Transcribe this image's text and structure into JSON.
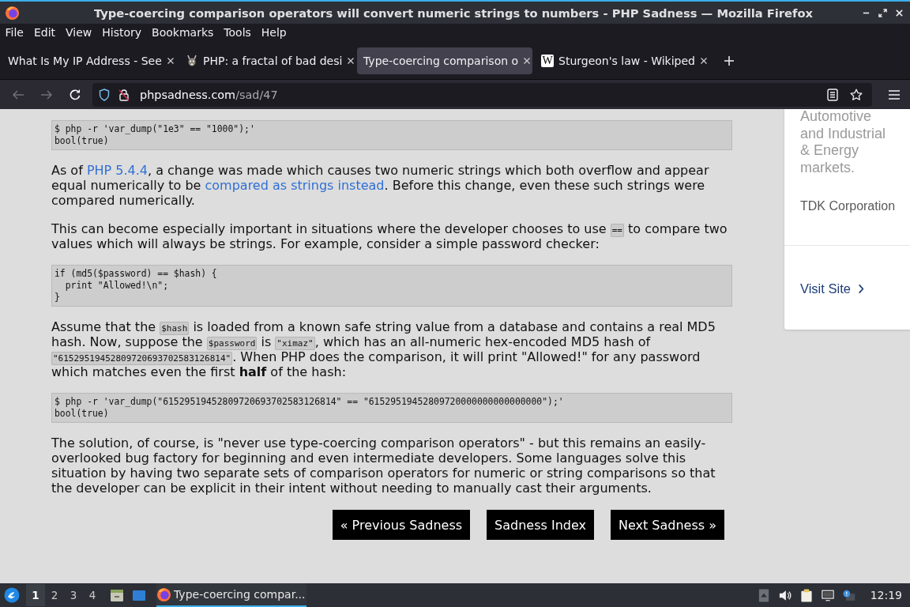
{
  "window": {
    "title": "Type-coercing comparison operators will convert numeric strings to numbers - PHP Sadness — Mozilla Firefox"
  },
  "menu": [
    "File",
    "Edit",
    "View",
    "History",
    "Bookmarks",
    "Tools",
    "Help"
  ],
  "tabs": [
    {
      "label": "What Is My IP Address - See",
      "kind": "plain",
      "selected": false
    },
    {
      "label": "PHP: a fractal of bad desi",
      "kind": "picture",
      "selected": false
    },
    {
      "label": "Type-coercing comparison o",
      "kind": "plain",
      "selected": true
    },
    {
      "label": "Sturgeon's law - Wikiped",
      "kind": "letter",
      "letter": "W",
      "selected": false
    }
  ],
  "nav_buttons": [
    {
      "kind": "back",
      "disabled": true
    },
    {
      "kind": "forward",
      "disabled": true
    },
    {
      "kind": "reload",
      "disabled": false
    }
  ],
  "url": {
    "host": "phpsadness.com",
    "path": "/sad/47"
  },
  "article": [
    {
      "kind": "code",
      "text": "$ php -r 'var_dump(\"1e3\" == \"1000\");'\nbool(true)"
    },
    {
      "kind": "paragraph",
      "parts": [
        {
          "kind": "text",
          "text": "As of "
        },
        {
          "kind": "link",
          "text": "PHP 5.4.4"
        },
        {
          "kind": "text",
          "text": ", a change was made which causes two numeric strings which both overflow and appear equal numerically to be "
        },
        {
          "kind": "link",
          "text": "compared as strings instead"
        },
        {
          "kind": "text",
          "text": ". Before this change, even these such strings were compared numerically."
        }
      ]
    },
    {
      "kind": "paragraph",
      "parts": [
        {
          "kind": "text",
          "text": "This can become especially important in situations where the developer chooses to use "
        },
        {
          "kind": "code",
          "text": "=="
        },
        {
          "kind": "text",
          "text": " to compare two values which will always be strings. For example, consider a simple password checker:"
        }
      ]
    },
    {
      "kind": "code",
      "text": "if (md5($password) == $hash) {\n  print \"Allowed!\\n\";\n}"
    },
    {
      "kind": "paragraph",
      "parts": [
        {
          "kind": "text",
          "text": "Assume that the "
        },
        {
          "kind": "code",
          "text": "$hash"
        },
        {
          "kind": "text",
          "text": " is loaded from a known safe string value from a database and contains a real MD5 hash. Now, suppose the "
        },
        {
          "kind": "code",
          "text": "$password"
        },
        {
          "kind": "text",
          "text": " is "
        },
        {
          "kind": "code",
          "text": "\"ximaz\""
        },
        {
          "kind": "text",
          "text": ", which has an all-numeric hex-encoded MD5 hash of "
        },
        {
          "kind": "code",
          "text": "\"61529519452809720693702583126814\""
        },
        {
          "kind": "text",
          "text": ". When PHP does the comparison, it will print \"Allowed!\" for any password which matches even the first **half** of the hash:"
        }
      ]
    },
    {
      "kind": "code",
      "text": "$ php -r 'var_dump(\"61529519452809720693702583126814\" == \"61529519452809720000000000000000\");'\nbool(true)"
    },
    {
      "kind": "paragraph",
      "parts": [
        {
          "kind": "text",
          "text": "The solution, of course, is \"never use type-coercing comparison operators\" - but this remains an easily-overlooked bug factory for beginning and even intermediate developers. Some languages solve this situation by having two separate sets of comparison operators for numeric or string comparisons so that the developer can be explicit in their intent without needing to manually cast their arguments."
        }
      ]
    }
  ],
  "pager": [
    "« Previous Sadness",
    "Sadness Index",
    "Next Sadness »"
  ],
  "ad": {
    "text": "Automotive and Industrial & Energy markets.",
    "company": "TDK Corporation",
    "link": "Visit Site"
  },
  "taskbar": {
    "workspaces": [
      {
        "label": "1",
        "selected": true
      },
      {
        "label": "2",
        "selected": false
      },
      {
        "label": "3",
        "selected": false
      },
      {
        "label": "4",
        "selected": false
      }
    ],
    "task": {
      "label": "Type-coercing compar...",
      "selected": true
    },
    "clock": "12:19"
  }
}
